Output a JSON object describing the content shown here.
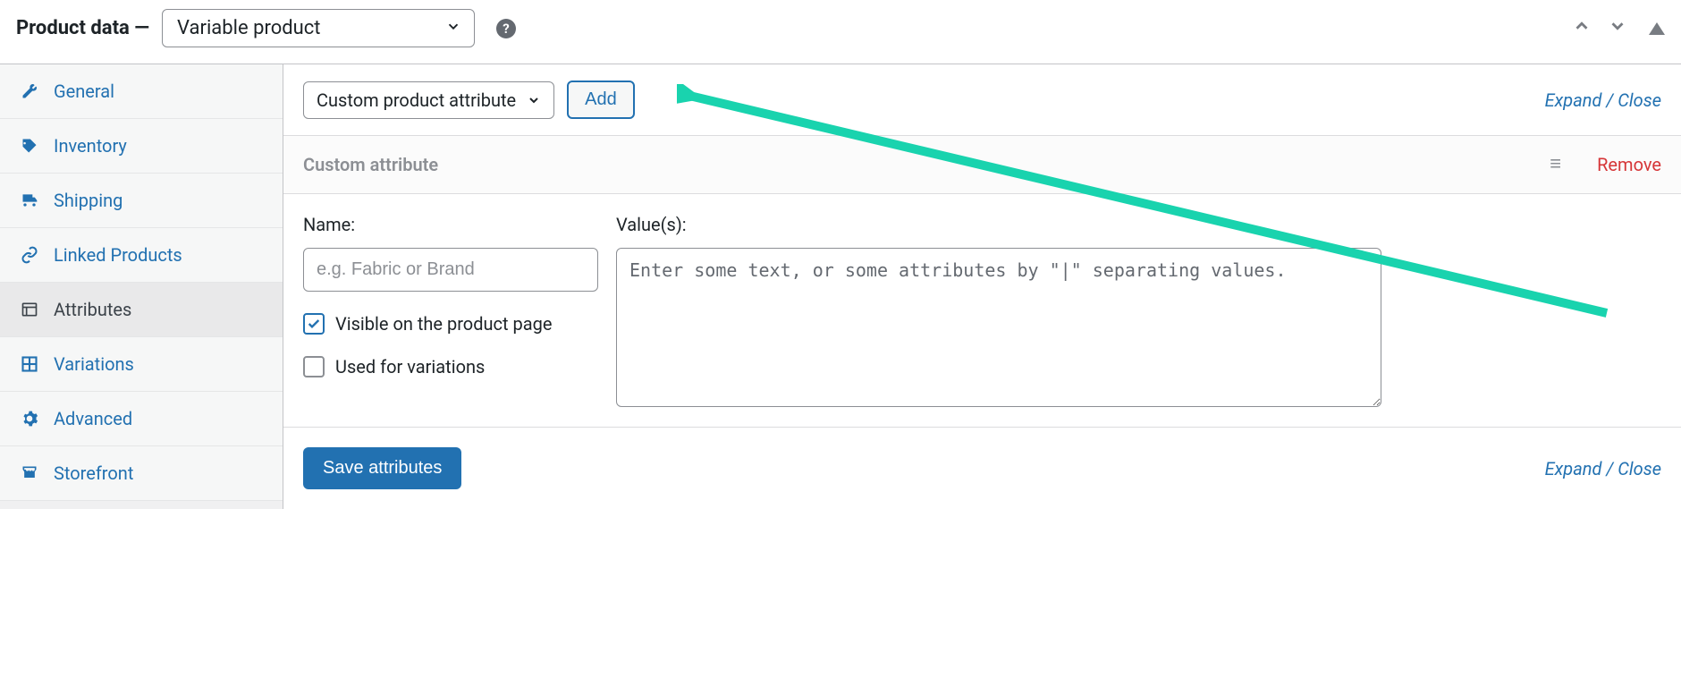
{
  "header": {
    "title": "Product data —",
    "product_type": "Variable product"
  },
  "sidebar": {
    "items": [
      {
        "label": "General"
      },
      {
        "label": "Inventory"
      },
      {
        "label": "Shipping"
      },
      {
        "label": "Linked Products"
      },
      {
        "label": "Attributes"
      },
      {
        "label": "Variations"
      },
      {
        "label": "Advanced"
      },
      {
        "label": "Storefront"
      }
    ]
  },
  "toolbar": {
    "select_label": "Custom product attribute",
    "add_label": "Add",
    "expand_label": "Expand",
    "close_label": "Close"
  },
  "attribute": {
    "header": "Custom attribute",
    "remove_label": "Remove",
    "name_label": "Name:",
    "name_placeholder": "e.g. Fabric or Brand",
    "values_label": "Value(s):",
    "values_placeholder": "Enter some text, or some attributes by \"|\" separating values.",
    "visible_label": "Visible on the product page",
    "variations_label": "Used for variations"
  },
  "footer": {
    "save_label": "Save attributes",
    "expand_label": "Expand",
    "close_label": "Close"
  }
}
